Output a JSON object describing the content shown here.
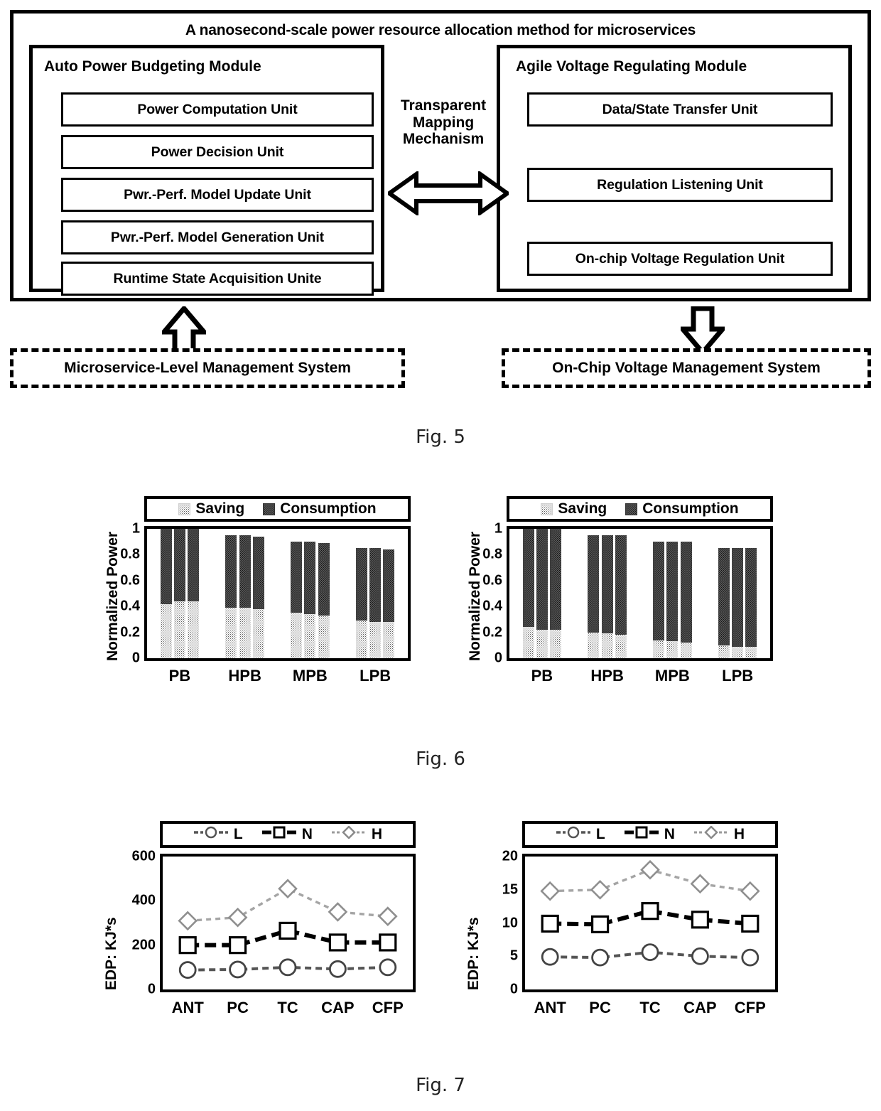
{
  "figures": [
    {
      "caption": "Fig. 5"
    },
    {
      "caption": "Fig. 6"
    },
    {
      "caption": "Fig. 7"
    }
  ],
  "fig5": {
    "title": "A nanosecond-scale power resource allocation method for microservices",
    "left_module": {
      "title": "Auto Power Budgeting Module",
      "units": [
        "Power Computation Unit",
        "Power Decision Unit",
        "Pwr.-Perf. Model Update Unit",
        "Pwr.-Perf. Model Generation Unit",
        "Runtime State Acquisition Unite"
      ]
    },
    "right_module": {
      "title": "Agile Voltage Regulating Module",
      "units": [
        "Data/State Transfer Unit",
        "Regulation Listening Unit",
        "On-chip Voltage Regulation Unit"
      ]
    },
    "mapping_label": "Transparent\nMapping\nMechanism",
    "mapping_label_lines": [
      "Transparent",
      "Mapping",
      "Mechanism"
    ],
    "bottom_left_system": "Microservice-Level Management System",
    "bottom_right_system": "On-Chip Voltage Management System",
    "arrow_up_name": "up-block-arrow",
    "arrow_down_name": "down-block-arrow",
    "arrow_bidirectional_name": "bidirectional-block-arrow"
  },
  "chart_data": [
    {
      "id": "fig6-left",
      "type": "bar",
      "title": "",
      "xlabel": "",
      "ylabel": "Normalized Power",
      "ylim": [
        0,
        1
      ],
      "yticks": [
        1,
        0.8,
        0.6,
        0.4,
        0.2,
        0
      ],
      "ytick_labels": [
        "1",
        "0.8",
        "0.6",
        "0.4",
        "0.2",
        "0"
      ],
      "categories": [
        "PB",
        "HPB",
        "MPB",
        "LPB"
      ],
      "bars_per_category": 3,
      "legend": [
        "Saving",
        "Consumption"
      ],
      "legend_position": "top",
      "stacked": true,
      "totals": [
        [
          1.0,
          1.0,
          1.0
        ],
        [
          0.95,
          0.95,
          0.94
        ],
        [
          0.9,
          0.9,
          0.89
        ],
        [
          0.85,
          0.85,
          0.84
        ]
      ],
      "saving": [
        [
          0.42,
          0.44,
          0.44
        ],
        [
          0.39,
          0.39,
          0.38
        ],
        [
          0.35,
          0.34,
          0.33
        ],
        [
          0.29,
          0.28,
          0.28
        ]
      ]
    },
    {
      "id": "fig6-right",
      "type": "bar",
      "title": "",
      "xlabel": "",
      "ylabel": "Normalized Power",
      "ylim": [
        0,
        1
      ],
      "yticks": [
        1,
        0.8,
        0.6,
        0.4,
        0.2,
        0
      ],
      "ytick_labels": [
        "1",
        "0.8",
        "0.6",
        "0.4",
        "0.2",
        "0"
      ],
      "categories": [
        "PB",
        "HPB",
        "MPB",
        "LPB"
      ],
      "bars_per_category": 3,
      "legend": [
        "Saving",
        "Consumption"
      ],
      "legend_position": "top",
      "stacked": true,
      "totals": [
        [
          1.0,
          1.0,
          1.0
        ],
        [
          0.95,
          0.95,
          0.95
        ],
        [
          0.9,
          0.9,
          0.9
        ],
        [
          0.85,
          0.85,
          0.85
        ]
      ],
      "saving": [
        [
          0.24,
          0.22,
          0.22
        ],
        [
          0.2,
          0.19,
          0.18
        ],
        [
          0.14,
          0.13,
          0.12
        ],
        [
          0.1,
          0.09,
          0.09
        ]
      ]
    },
    {
      "id": "fig7-left",
      "type": "line",
      "title": "",
      "xlabel": "",
      "ylabel": "EDP: KJ*s",
      "ylim": [
        0,
        600
      ],
      "yticks": [
        600,
        400,
        200,
        0
      ],
      "ytick_labels": [
        "600",
        "400",
        "200",
        "0"
      ],
      "x": [
        "ANT",
        "PC",
        "TC",
        "CAP",
        "CFP"
      ],
      "legend": [
        "L",
        "N",
        "H"
      ],
      "legend_position": "top",
      "series": [
        {
          "name": "L",
          "marker": "circle",
          "values": [
            88,
            90,
            100,
            92,
            100
          ]
        },
        {
          "name": "N",
          "marker": "square",
          "values": [
            200,
            200,
            265,
            212,
            212
          ]
        },
        {
          "name": "H",
          "marker": "diamond",
          "values": [
            310,
            325,
            455,
            350,
            330
          ]
        }
      ]
    },
    {
      "id": "fig7-right",
      "type": "line",
      "title": "",
      "xlabel": "",
      "ylabel": "EDP: KJ*s",
      "ylim": [
        0,
        20
      ],
      "yticks": [
        20,
        15,
        10,
        5,
        0
      ],
      "ytick_labels": [
        "20",
        "15",
        "10",
        "5",
        "0"
      ],
      "x": [
        "ANT",
        "PC",
        "TC",
        "CAP",
        "CFP"
      ],
      "legend": [
        "L",
        "N",
        "H"
      ],
      "legend_position": "top",
      "series": [
        {
          "name": "L",
          "marker": "circle",
          "values": [
            4.9,
            4.8,
            5.6,
            5.0,
            4.8
          ]
        },
        {
          "name": "N",
          "marker": "square",
          "values": [
            9.9,
            9.8,
            11.8,
            10.5,
            9.9
          ]
        },
        {
          "name": "H",
          "marker": "diamond",
          "values": [
            14.8,
            15.0,
            18.0,
            15.9,
            14.8
          ]
        }
      ]
    }
  ]
}
